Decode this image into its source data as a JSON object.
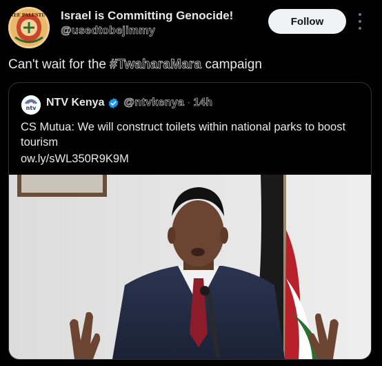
{
  "post": {
    "author": {
      "display_name": "Israel is Committing Genocide!",
      "handle": "@usedtobejimmy",
      "avatar_text": "FREE PALESTINE"
    },
    "follow_label": "Follow",
    "text_before": "Can't wait for the ",
    "hashtag": "#TwaharaMara",
    "text_after": " campaign"
  },
  "quote": {
    "author": {
      "display_name": "NTV Kenya",
      "handle": "@ntvkenya",
      "avatar_text": "ntv"
    },
    "separator": "·",
    "time": "14h",
    "text": "CS Mutua: We will construct toilets within national parks to boost tourism",
    "link": "ow.ly/sWL350R9K9M"
  },
  "icons": {
    "more": "more-vertical-icon",
    "verified": "verified-badge-icon"
  },
  "colors": {
    "background": "#000000",
    "text": "#e7e9ea",
    "secondary_text": "#71767b",
    "border": "#2f3336",
    "follow_button_bg": "#eff3f4",
    "verified_blue": "#1d9bf0"
  }
}
